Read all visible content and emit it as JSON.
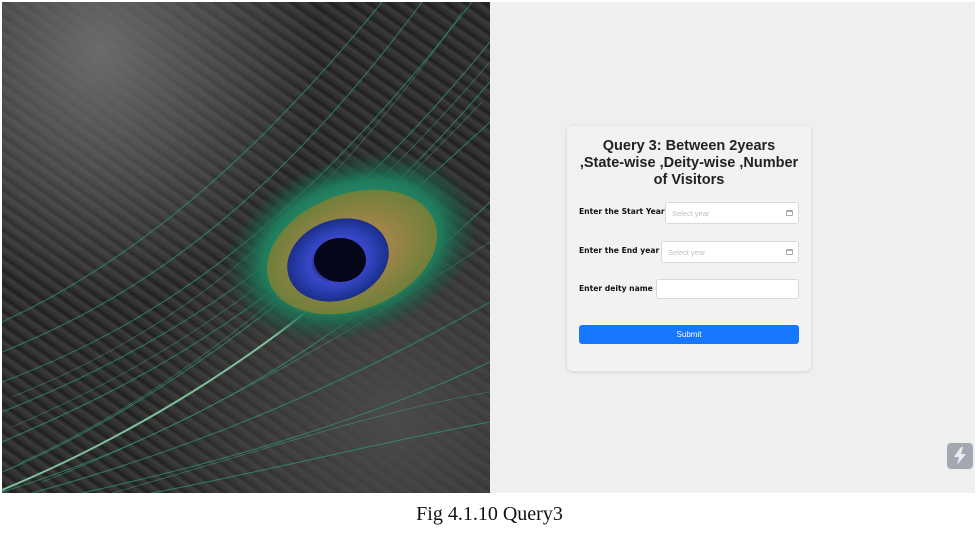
{
  "form": {
    "title": "Query 3: Between 2years ,State-wise ,Deity-wise ,Number of Visitors",
    "start_year_label": "Enter the Start Year :",
    "start_year_placeholder": "Select year",
    "end_year_label": "Enter the End year :",
    "end_year_placeholder": "Select year",
    "deity_label": "Enter deity name :",
    "deity_value": "",
    "submit_label": "Submit"
  },
  "colors": {
    "primary": "#1677ff",
    "background": "#efefef"
  },
  "icons": {
    "calendar": "calendar-icon",
    "floating_button": "lightning-icon"
  },
  "caption": "Fig 4.1.10 Query3"
}
